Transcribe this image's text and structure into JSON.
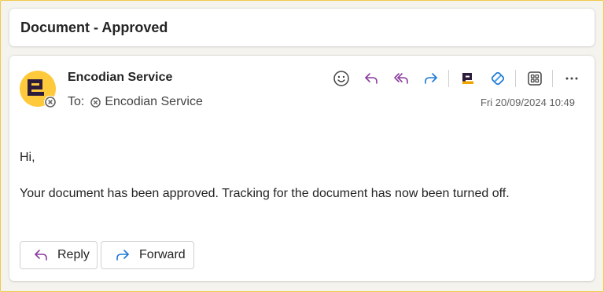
{
  "subject": "Document - Approved",
  "sender": {
    "name": "Encodian Service"
  },
  "recipients": {
    "to_label": "To:",
    "to_name": "Encodian Service"
  },
  "date": "Fri 20/09/2024 10:49",
  "body": {
    "greeting": "Hi,",
    "message": "Your document has been approved. Tracking for the document has now been turned off."
  },
  "actions": {
    "reply_label": "Reply",
    "forward_label": "Forward"
  },
  "toolbar_icons": [
    "emoji-icon",
    "reply-icon",
    "reply-all-icon",
    "forward-icon",
    "encodian-app-icon",
    "loop-icon",
    "apps-icon",
    "more-icon"
  ],
  "colors": {
    "accent_purple": "#8a3c9e",
    "accent_blue": "#1e78d6",
    "avatar_yellow": "#ffc93c",
    "brand_dark": "#2d1b3c"
  }
}
